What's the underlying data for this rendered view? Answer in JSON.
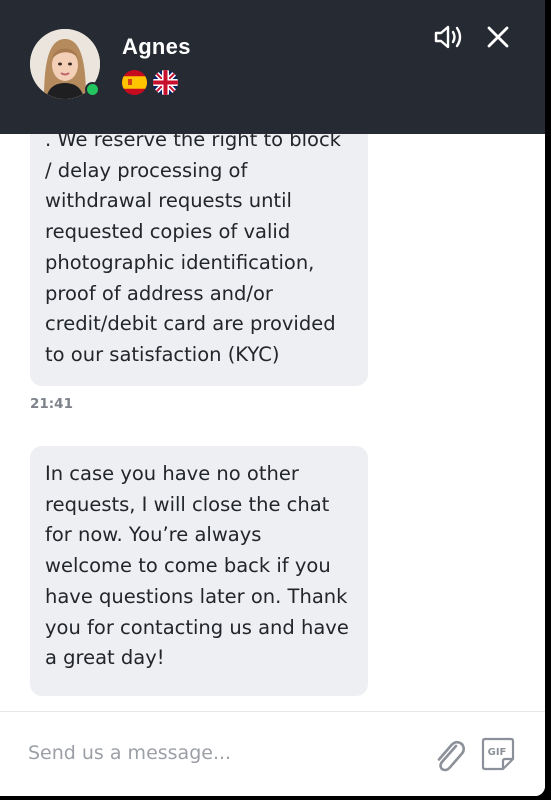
{
  "header": {
    "agent_name": "Agnes",
    "status": "online",
    "languages": [
      "spanish-flag-icon",
      "uk-flag-icon"
    ],
    "icons": {
      "sound": "speaker-icon",
      "close": "close-icon"
    },
    "colors": {
      "background": "#262b33",
      "online": "#22c55e"
    }
  },
  "messages": [
    {
      "text": ". We reserve the right to block / delay processing of withdrawal requests until requested copies of valid photographic identification, proof of address and/or credit/debit card are provided to our satisfaction (KYC)",
      "time": "21:41"
    },
    {
      "text": "In case you have no other requests, I will close the chat for now. You’re always welcome to come back if you have questions later on. Thank you for contacting us and have a great day!"
    }
  ],
  "composer": {
    "placeholder": "Send us a message...",
    "value": "",
    "icons": {
      "attach": "paperclip-icon",
      "gif": "gif-icon"
    }
  }
}
